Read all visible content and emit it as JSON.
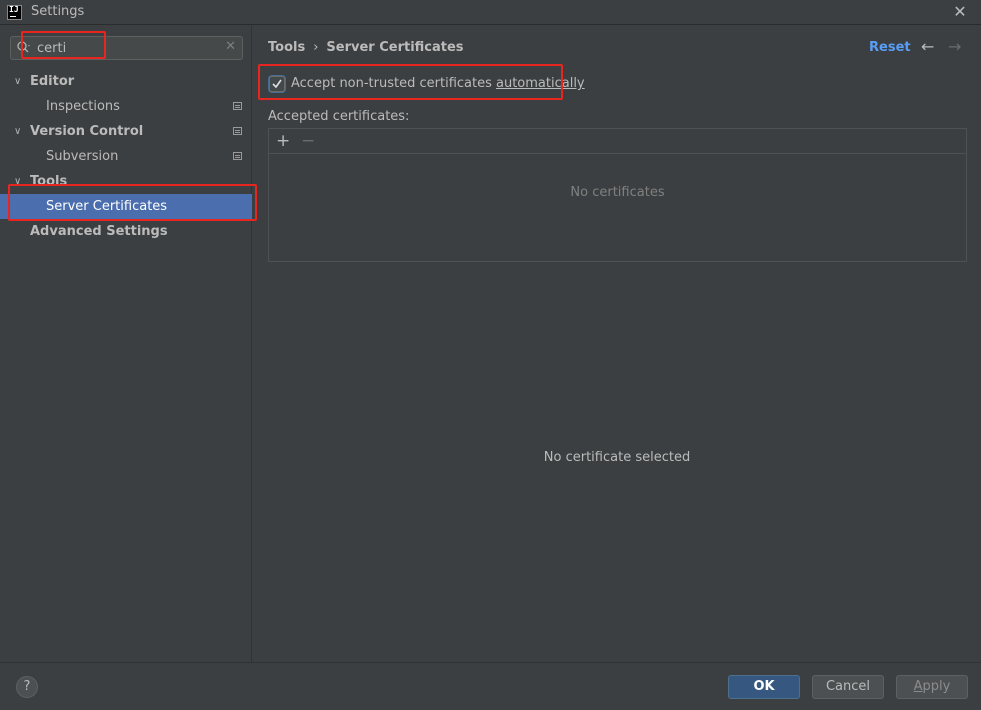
{
  "window": {
    "title": "Settings",
    "logo_text": "IJ"
  },
  "search": {
    "value": "certi",
    "placeholder": ""
  },
  "sidebar": {
    "items": [
      {
        "label": "Editor",
        "kind": "group",
        "expanded": true
      },
      {
        "label": "Inspections",
        "kind": "child"
      },
      {
        "label": "Version Control",
        "kind": "group",
        "expanded": true
      },
      {
        "label": "Subversion",
        "kind": "child"
      },
      {
        "label": "Tools",
        "kind": "group",
        "expanded": true
      },
      {
        "label": "Server Certificates",
        "kind": "child",
        "selected": true
      },
      {
        "label": "Advanced Settings",
        "kind": "group-leaf"
      }
    ]
  },
  "header": {
    "breadcrumb_parent": "Tools",
    "breadcrumb_separator": "›",
    "breadcrumb_current": "Server Certificates",
    "reset_label": "Reset"
  },
  "settings": {
    "accept_checkbox_label_prefix": "Accept non-trusted certificates ",
    "accept_checkbox_label_mnemonic": "automatically",
    "accept_checked": true,
    "accepted_label": "Accepted certificates:",
    "empty_text": "No certificates",
    "no_selection_text": "No certificate selected"
  },
  "footer": {
    "help_label": "?",
    "ok_label": "OK",
    "cancel_label": "Cancel",
    "apply_mnemonic": "A",
    "apply_rest": "pply"
  },
  "colors": {
    "background": "#3c3f41",
    "selection": "#4b6eaf",
    "link": "#589df6",
    "primary_button": "#365880",
    "highlight_annotation": "#e8251f"
  }
}
